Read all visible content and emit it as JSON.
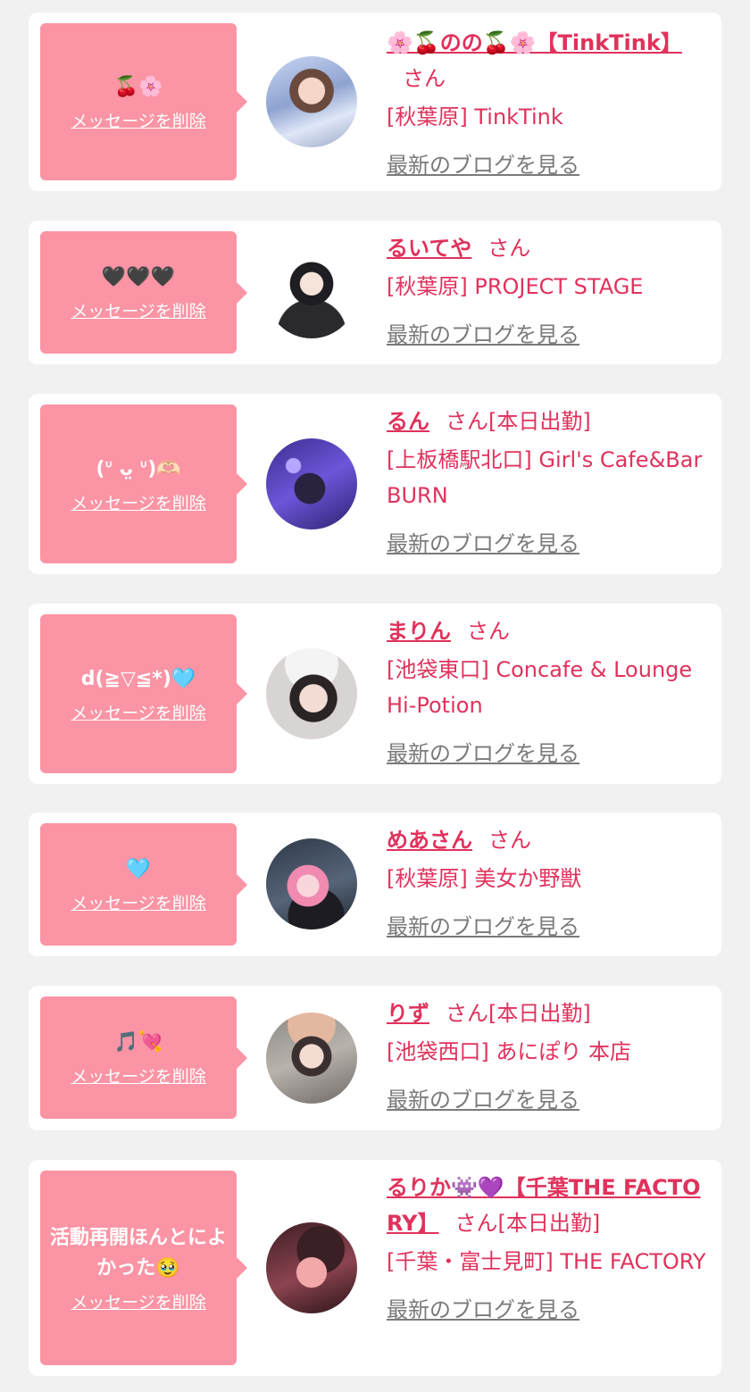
{
  "delete_label": "メッセージを削除",
  "blog_label": "最新のブログを見る",
  "colors": {
    "page_bg": "#f1f1f1",
    "card_bg": "#ffffff",
    "bubble_bg": "#fb94a4",
    "accent_text": "#e0325c",
    "link_gray": "#7a7a7a"
  },
  "entries": [
    {
      "message": "🍒🌸",
      "name": "🌸🍒のの🍒🌸【TinkTink】",
      "suffix": "さん",
      "shop": "[秋葉原] TinkTink",
      "avatar_icon": "profile-photo"
    },
    {
      "message": "🖤🖤🖤",
      "name": "るいてや",
      "suffix": "さん",
      "shop": "[秋葉原] PROJECT STAGE",
      "avatar_icon": "profile-photo"
    },
    {
      "message": "(ᐡ ᴗ̤ ᐡ)🫶🏻",
      "name": "るん",
      "suffix": "さん[本日出勤]",
      "shop": "[上板橋駅北口] Girl's Cafe&Bar BURN",
      "avatar_icon": "profile-photo"
    },
    {
      "message": "d(≧▽≦*)🩵",
      "name": "まりん",
      "suffix": "さん",
      "shop": "[池袋東口] Concafe & Lounge Hi-Potion",
      "avatar_icon": "profile-photo"
    },
    {
      "message": "🩵",
      "name": "めあさん",
      "suffix": "さん",
      "shop": "[秋葉原] 美女か野獣",
      "avatar_icon": "profile-photo"
    },
    {
      "message": "🎵💘",
      "name": "りず",
      "suffix": "さん[本日出勤]",
      "shop": "[池袋西口] あにぽり 本店",
      "avatar_icon": "profile-photo"
    },
    {
      "message": "活動再開ほんとによかった🥹",
      "name": "るりか👾💜【千葉THE FACTORY】",
      "suffix": "さん[本日出勤]",
      "shop": "[千葉・富士見町] THE FACTORY",
      "avatar_icon": "profile-photo"
    }
  ]
}
